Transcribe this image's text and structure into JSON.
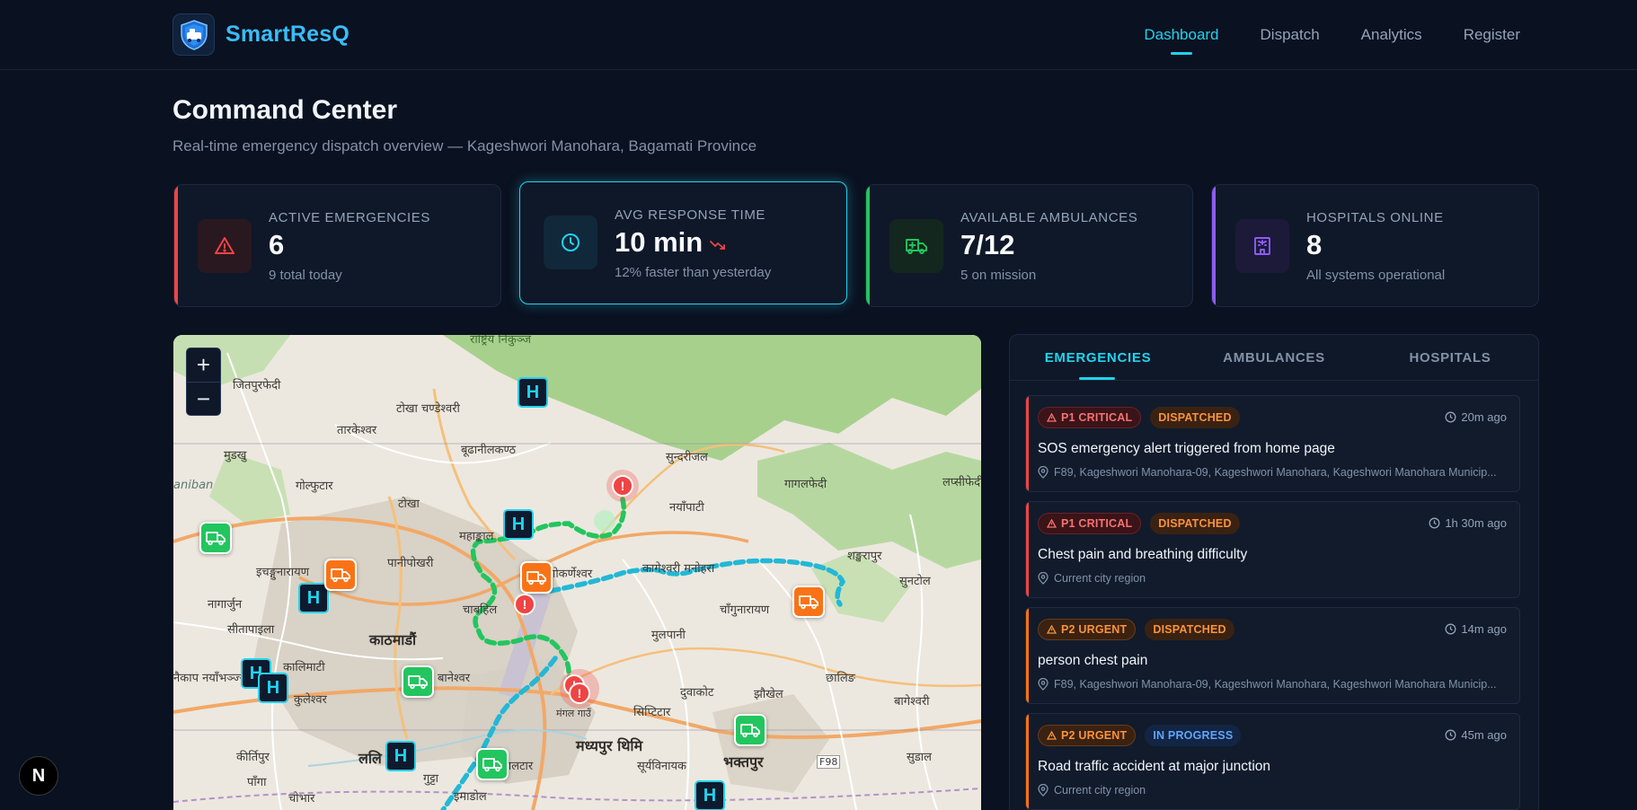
{
  "app": {
    "name": "SmartResQ",
    "logo_icon": "shield-ambulance-icon"
  },
  "nav": {
    "links": [
      {
        "label": "Dashboard",
        "active": true
      },
      {
        "label": "Dispatch",
        "active": false
      },
      {
        "label": "Analytics",
        "active": false
      },
      {
        "label": "Register",
        "active": false
      }
    ]
  },
  "header": {
    "title": "Command Center",
    "subtitle": "Real-time emergency dispatch overview — Kageshwori Manohara, Bagamati Province"
  },
  "stats": [
    {
      "label": "ACTIVE EMERGENCIES",
      "value": "6",
      "sub": "9 total today",
      "icon": "alert-triangle-icon",
      "accent": "#ef4444"
    },
    {
      "label": "AVG RESPONSE TIME",
      "value": "10 min",
      "sub": "12% faster than yesterday",
      "icon": "clock-icon",
      "accent": "#22d3ee",
      "trend_icon": "trending-down-icon"
    },
    {
      "label": "AVAILABLE AMBULANCES",
      "value": "7/12",
      "sub": "5 on mission",
      "icon": "ambulance-icon",
      "accent": "#22c55e"
    },
    {
      "label": "HOSPITALS ONLINE",
      "value": "8",
      "sub": "All systems operational",
      "icon": "hospital-building-icon",
      "accent": "#8b5cf6"
    }
  ],
  "map": {
    "zoom_in": "+",
    "zoom_out": "−",
    "hospital_marker_label": "H",
    "alert_marker_label": "!",
    "labels": {
      "top_banner": "राष्ट्रिय निकुञ्ज",
      "jitpurphedi": "जितपुरफेदी",
      "tokha_chandeshwori": "टोखा चण्डेश्वरी",
      "tarakeshwar": "तारकेश्वर",
      "budhanilkantha": "बूढानीलकण्ठ",
      "sundarijal": "सुन्दरीजल",
      "mudkhu": "मुडखु",
      "golphutar": "गोल्फुटार",
      "gagalphedi": "गागलफेदी",
      "lapsiphedi": "लप्सीफेदी",
      "daniban": "aniban",
      "tokha": "टोखा",
      "nayapati": "नयाँपाटी",
      "mahankal": "महाङ्काल",
      "paniphokhari": "पानीपोखरी",
      "gokarneshwar": "गोकर्णेश्वर",
      "kageshwori_manohara": "कागेश्वरी मनोहरा",
      "shankharapur": "शङ्खरापुर",
      "sundar": "सुनटोल",
      "ichangunarayan": "इचङ्गुनारायण",
      "nagarjun": "नागार्जुन",
      "chabahil": "चाबहिल",
      "changunarayan": "चाँगुनारायण",
      "sitapaila": "सीतापाइला",
      "kathmandu": "काठमाडौं",
      "mulpani": "मुलपानी",
      "kalimati": "कालिमाटी",
      "baneshwar": "बानेश्वर",
      "chhaling": "छालिङ",
      "nakhipot": "नैकाप नयाँभञ्ज्याङ",
      "kuleshwar": "कुलेश्वर",
      "duwakot": "दुवाकोट",
      "jhaukhel": "झौखेल",
      "bageshwori": "बागेश्वरी",
      "mangalbazar": "मंगल गाउँ",
      "sipadol": "सिप्टिटार",
      "kirtipur": "कीर्तिपुर",
      "lalitpur": "ललि",
      "madhyapur_thimi": "मध्यपुर थिमि",
      "sudal": "सुडाल",
      "pangga": "पाँगा",
      "gutta": "गुट्टा",
      "kaushaltar": "कौशलटार",
      "suryabinayak": "सूर्यविनायक",
      "bhaktapur": "भक्तपुर",
      "chobhar": "चोभार",
      "imadol": "इमाडोल",
      "f98": "F98"
    }
  },
  "panel": {
    "tabs": [
      {
        "label": "EMERGENCIES",
        "active": true
      },
      {
        "label": "AMBULANCES",
        "active": false
      },
      {
        "label": "HOSPITALS",
        "active": false
      }
    ],
    "emergencies": [
      {
        "priority": "P1 CRITICAL",
        "priority_level": "p1",
        "status": "DISPATCHED",
        "status_kind": "dispatched",
        "time": "20m ago",
        "title": "SOS emergency alert triggered from home page",
        "location": "F89, Kageshwori Manohara-09, Kageshwori Manohara, Kageshwori Manohara Municip..."
      },
      {
        "priority": "P1 CRITICAL",
        "priority_level": "p1",
        "status": "DISPATCHED",
        "status_kind": "dispatched",
        "time": "1h 30m ago",
        "title": "Chest pain and breathing difficulty",
        "location": "Current city region"
      },
      {
        "priority": "P2 URGENT",
        "priority_level": "p2",
        "status": "DISPATCHED",
        "status_kind": "dispatched",
        "time": "14m ago",
        "title": "person chest pain",
        "location": "F89, Kageshwori Manohara-09, Kageshwori Manohara, Kageshwori Manohara Municip..."
      },
      {
        "priority": "P2 URGENT",
        "priority_level": "p2",
        "status": "IN PROGRESS",
        "status_kind": "progress",
        "time": "45m ago",
        "title": "Road traffic accident at major junction",
        "location": "Current city region"
      }
    ]
  },
  "next_badge": "N",
  "colors": {
    "background": "#0a1120",
    "card": "#0f1828",
    "accent_cyan": "#22d3ee",
    "critical": "#ef4444",
    "urgent": "#f97316",
    "available": "#22c55e",
    "hospital": "#8b5cf6"
  }
}
